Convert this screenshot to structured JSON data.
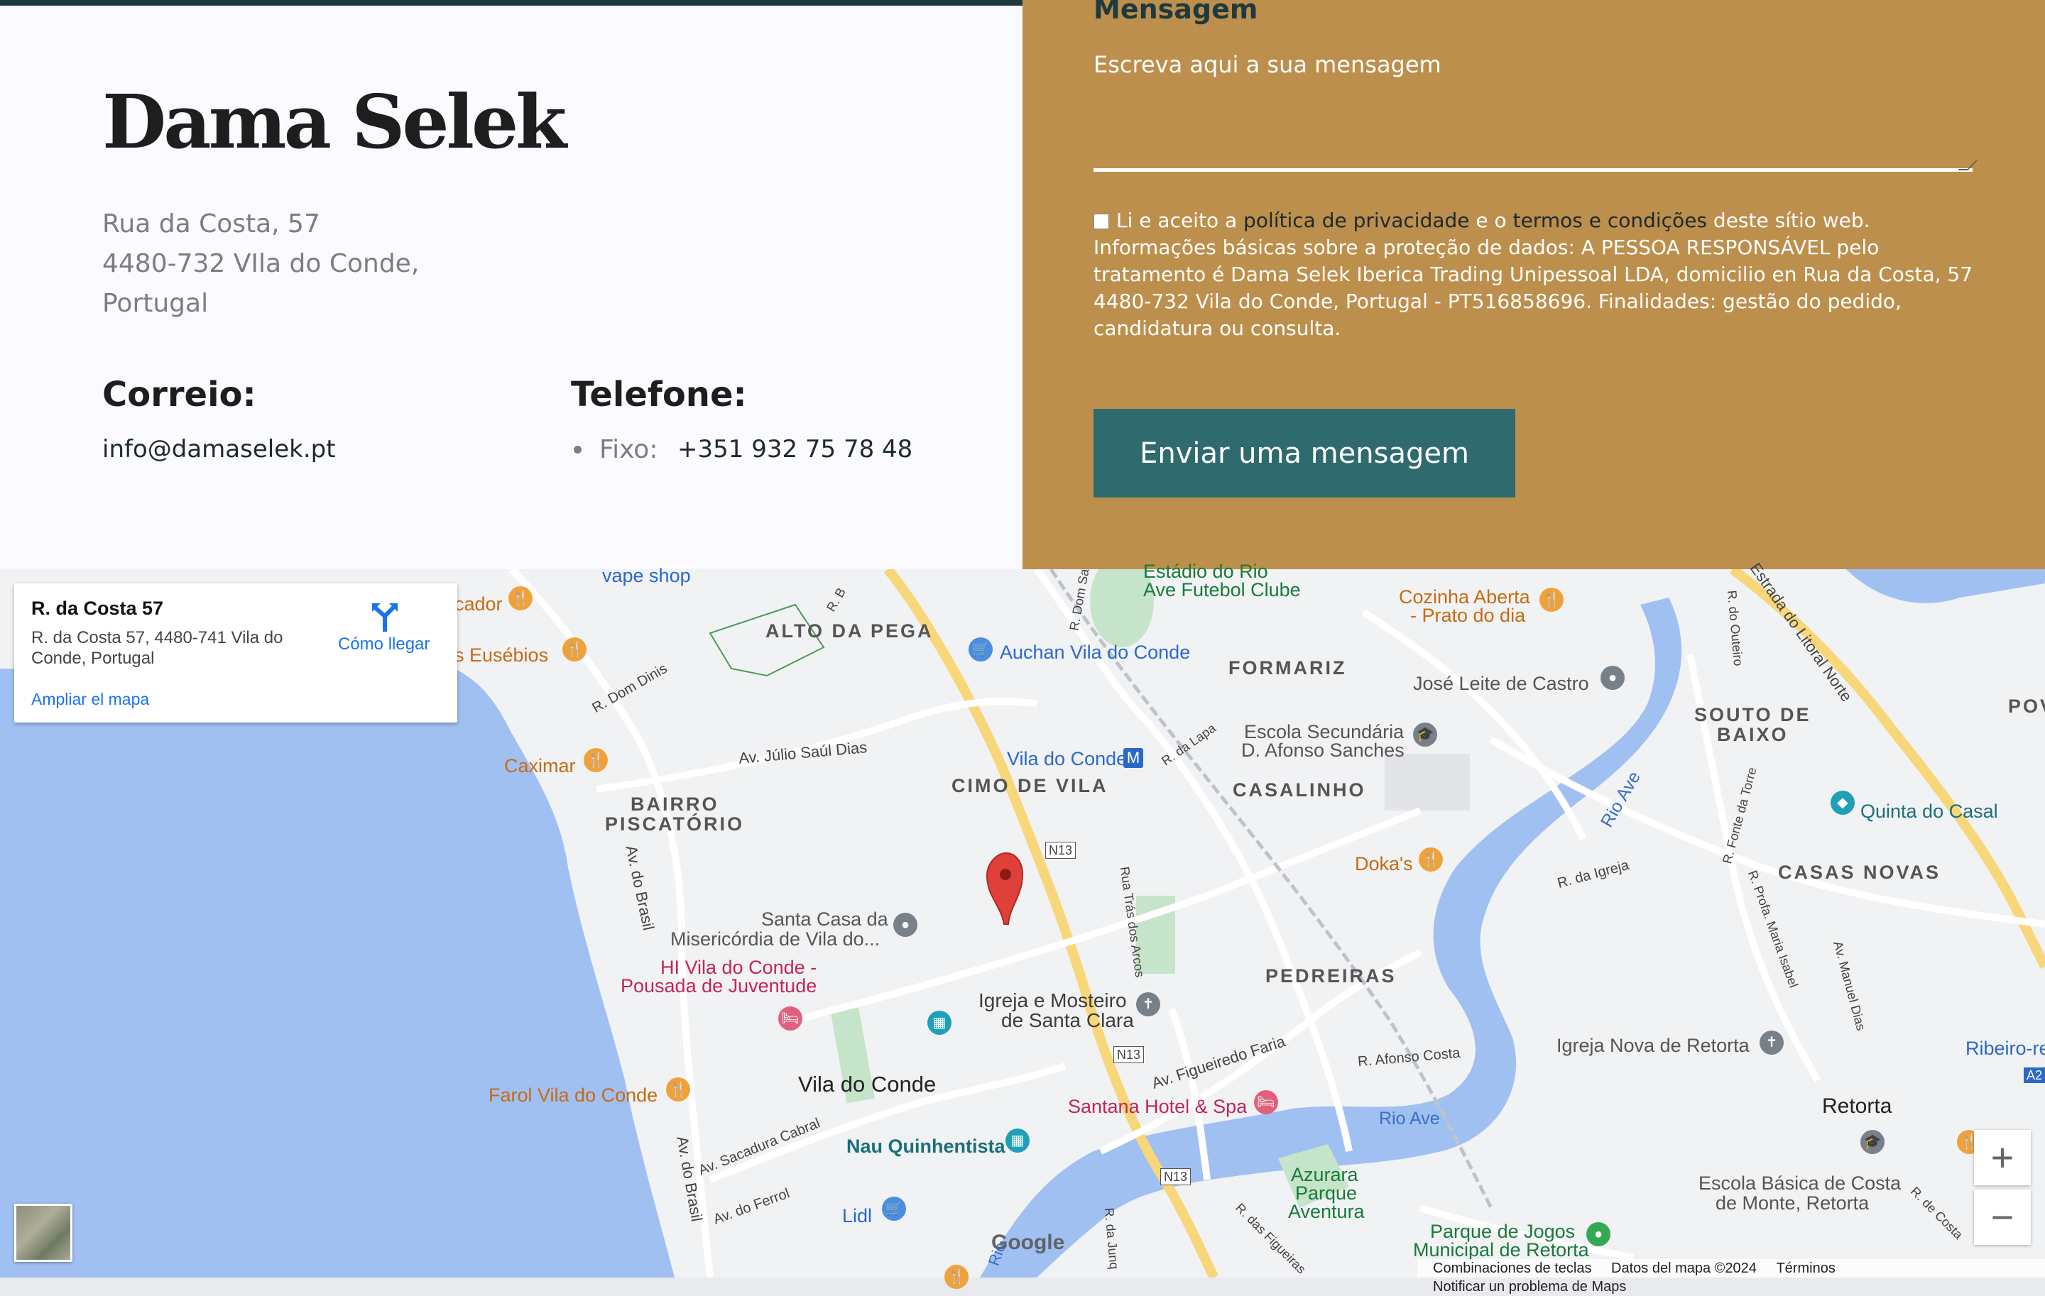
{
  "contact": {
    "brand": "Dama Selek",
    "address_line1": "Rua da Costa, 57",
    "address_line2": "4480-732 VIla do Conde,",
    "address_line3": "Portugal",
    "email_heading": "Correio:",
    "email": "info@damaselek.pt",
    "phone_heading": "Telefone:",
    "phone_label": "Fixo:",
    "phone": "+351 932 75 78 48"
  },
  "form": {
    "message_label": "Mensagem",
    "message_placeholder": "Escreva aqui a sua mensagem",
    "consent_pre": "Li e aceito a ",
    "privacy_link": "política de privacidade",
    "consent_mid": " e o ",
    "terms_link": "termos e condições",
    "consent_post": " deste sítio web.",
    "consent_info": "Informações básicas sobre a proteção de dados: A PESSOA RESPONSÁVEL pelo tratamento é Dama Selek Iberica Trading Unipessoal LDA, domicilio en Rua da Costa, 57 4480-732 Vila do Conde, Portugal - PT516858696. Finalidades: gestão do pedido, candidatura ou consulta.",
    "submit_label": "Enviar uma mensagem"
  },
  "map": {
    "card_title": "R. da Costa 57",
    "card_address": "R. da Costa 57, 4480-741 Vila do Conde, Portugal",
    "directions_label": "Cómo llegar",
    "enlarge_label": "Ampliar el mapa",
    "zoom_in": "+",
    "zoom_out": "−",
    "attribution": [
      "Combinaciones de teclas",
      "Datos del mapa ©2024",
      "Términos",
      "Notificar un problema de Maps"
    ],
    "google": "Google",
    "labels": {
      "vape_shop": "vape shop",
      "cador": "cador",
      "euseb": "s Eusébios",
      "caximar": "Caximar",
      "alto_pega": "ALTO DA PEGA",
      "auchan": "Auchan Vila do Conde",
      "estadio1": "Estádio do Rio",
      "estadio2": "Ave Futebol Clube",
      "cozinha1": "Cozinha Aberta",
      "cozinha2": "- Prato do dia",
      "formariz": "FORMARIZ",
      "jose": "José Leite de Castro",
      "souto1": "SOUTO DE",
      "souto2": "BAIXO",
      "pov": "POV",
      "escola1": "Escola Secundária",
      "escola2": "D. Afonso Sanches",
      "casalinho": "CASALINHO",
      "vila_metro": "Vila do Conde",
      "metro_m": "M",
      "cimo": "CIMO DE VILA",
      "bairro1": "BAIRRO",
      "bairro2": "PISCATÓRIO",
      "quinta": "Quinta do Casal",
      "casas": "CASAS NOVAS",
      "dokas": "Doka's",
      "n13a": "N13",
      "n13b": "N13",
      "n13c": "N13",
      "santa1": "Santa Casa da",
      "santa2": "Misericórdia de Vila do...",
      "hi1": "HI Vila do Conde -",
      "hi2": "Pousada de Juventude",
      "igreja1": "Igreja e Mosteiro",
      "igreja2": "de Santa Clara",
      "pedreiras": "PEDREIRAS",
      "igreja_nova": "Igreja Nova de Retorta",
      "ribeiro": "Ribeiro-re",
      "a28": "A2",
      "vila": "Vila do Conde",
      "farol": "Farol Vila do Conde",
      "santana": "Santana Hotel & Spa",
      "rio_ave": "Rio Ave",
      "rio_ave2": "Rio Ave",
      "retorta": "Retorta",
      "nau": "Nau Quinhentista",
      "azurara1": "Azurara",
      "azurara2": "Parque",
      "azurara3": "Aventura",
      "escola_basica1": "Escola Básica de Costa",
      "escola_basica2": "de Monte, Retorta",
      "lidl": "Lidl",
      "parque1": "Parque de Jogos",
      "parque2": "Municipal de Retorta",
      "st_julio": "Av. Júlio Saúl Dias",
      "st_dinis": "R. Dom Dinis",
      "st_brasil": "Av. do Brasil",
      "st_brasil2": "Av. do Brasil",
      "st_figueiredo": "Av. Figueiredo Faria",
      "st_litoral": "Estrada do Litoral Norte",
      "st_tras": "Rua Trás dos Arcos",
      "st_afonso": "R. Afonso Costa",
      "st_cabral": "Av. Sacadura Cabral",
      "st_ferrol": "Av. do Ferrol",
      "st_lapa": "R. da Lapa",
      "st_igreja": "R. da Igreja",
      "st_outeiro": "R. do Outeiro",
      "st_fonte": "R. Fonte da Torre",
      "st_maria": "R. Profa. Maria Isabel",
      "st_manuel": "Av. Manuel Dias",
      "st_dom": "R. Dom Sa",
      "st_rb": "R. B",
      "st_figueiras": "R. das Figueiras",
      "st_junq": "R. da Junq",
      "st_costa": "R. de Costa",
      "st_rio": "Rio"
    }
  }
}
